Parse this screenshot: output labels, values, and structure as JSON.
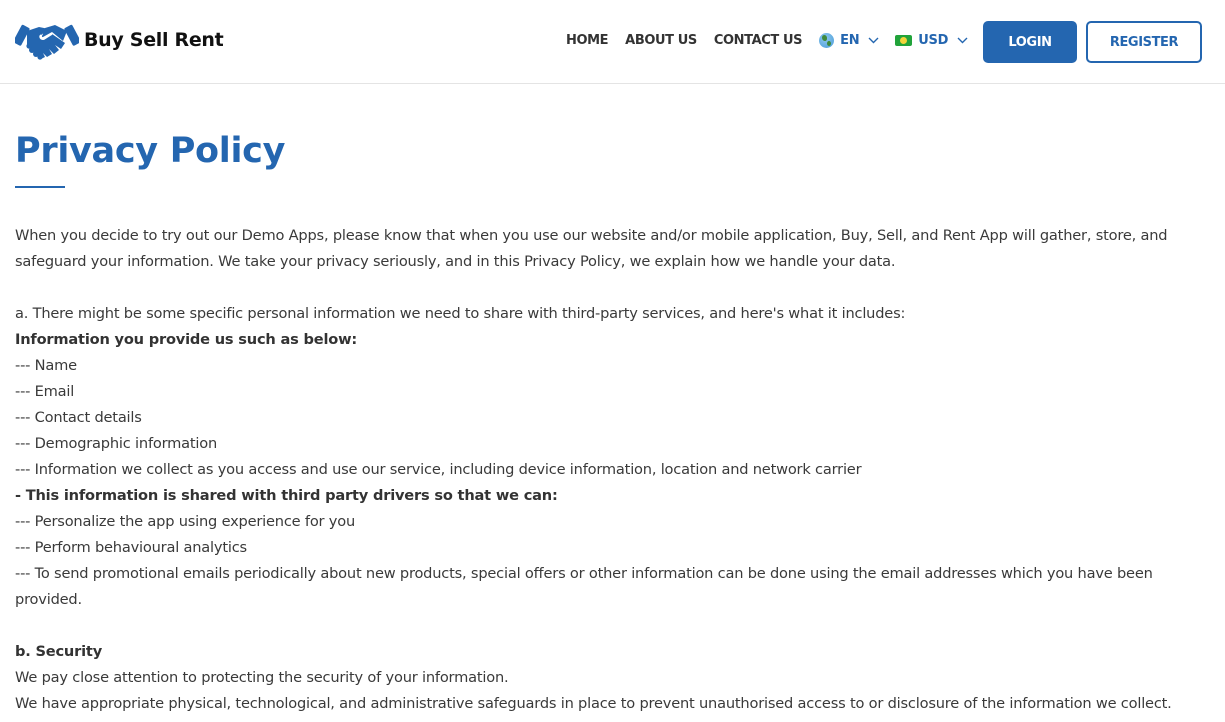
{
  "brand": {
    "name": "Buy Sell Rent",
    "logo_icon": "handshake-icon",
    "accent_color": "#2466b0"
  },
  "nav": {
    "links": [
      {
        "label": "HOME"
      },
      {
        "label": "ABOUT US"
      },
      {
        "label": "CONTACT US"
      }
    ],
    "language": {
      "icon": "globe-icon",
      "selected": "EN"
    },
    "currency": {
      "icon": "banknote-icon",
      "selected": "USD"
    },
    "login_label": "LOGIN",
    "register_label": "REGISTER"
  },
  "page": {
    "title": "Privacy Policy",
    "intro": "When you decide to try out our Demo Apps, please know that when you use our website and/or mobile application, Buy, Sell, and Rent App will gather, store, and safeguard your information. We take your privacy seriously, and in this Privacy Policy, we explain how we handle your data.",
    "section_a": {
      "heading": "a. There might be some specific personal information we need to share with third-party services, and here's what it includes:",
      "provided_heading": "Information you provide us such as below:",
      "provided_items": [
        "--- Name",
        "--- Email",
        "--- Contact details",
        "--- Demographic information",
        "--- Information we collect as you access and use our service, including device information, location and network carrier"
      ],
      "shared_heading": "- This information is shared with third party drivers so that we can:",
      "shared_items": [
        "--- Personalize the app using experience for you",
        "--- Perform behavioural analytics",
        "--- To send promotional emails periodically about new products, special offers or other information can be done using the email addresses which you have been provided."
      ]
    },
    "section_b": {
      "heading": "b. Security",
      "lines": [
        "We pay close attention to protecting the security of your information.",
        "We have appropriate physical, technological, and administrative safeguards in place to prevent unauthorised access to or disclosure of the information we collect."
      ]
    }
  }
}
